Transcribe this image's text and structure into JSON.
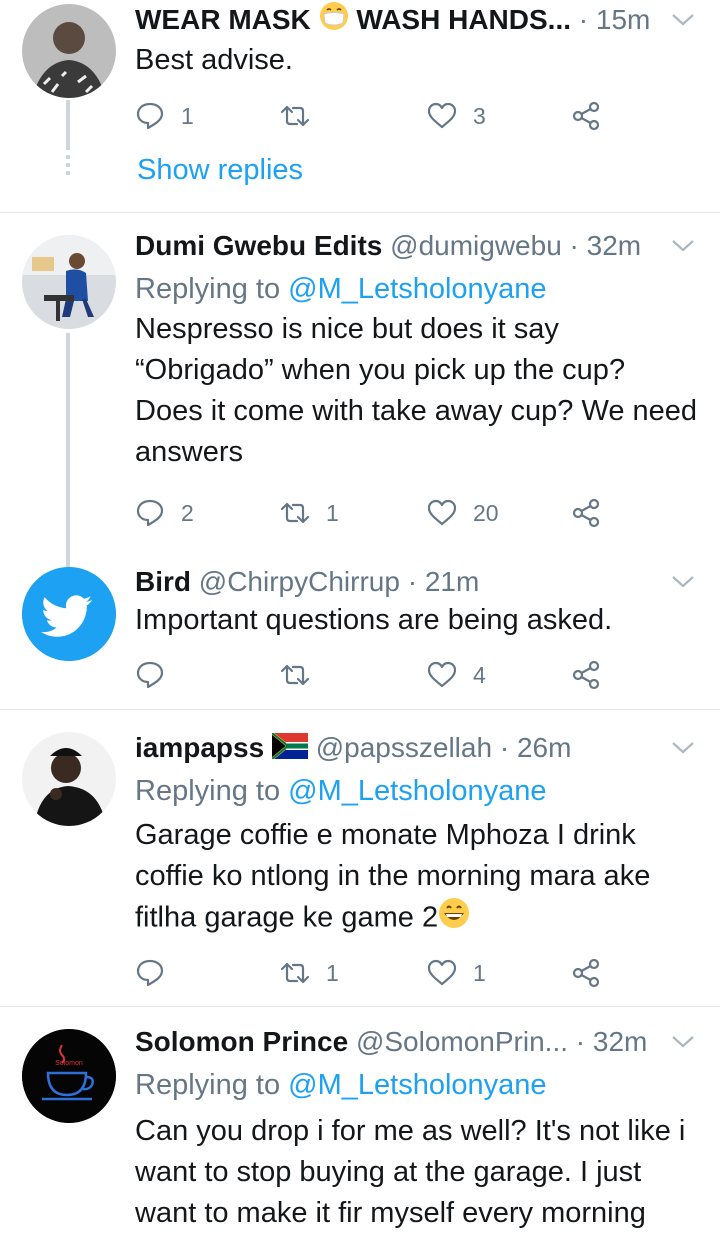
{
  "colors": {
    "accent": "#1da1f2",
    "secondary_text": "#657786",
    "divider": "#e1e8ed"
  },
  "tweets": [
    {
      "name": "WEAR MASK",
      "name_suffix": "WASH HANDS...",
      "handle": "",
      "time": "15m",
      "reply_label": "",
      "reply_to": "",
      "text": "Best advise.",
      "replies": "1",
      "retweets": "",
      "likes": "3",
      "show_replies": "Show replies"
    },
    {
      "name": "Dumi Gwebu Edits",
      "handle": "@dumigwebu",
      "time": "32m",
      "reply_label": "Replying to",
      "reply_to": "@M_Letsholonyane",
      "text": "Nespresso is nice but does it say “Obrigado” when you pick up the cup? Does it come with take away cup? We need answers",
      "replies": "2",
      "retweets": "1",
      "likes": "20"
    },
    {
      "name": "Bird",
      "handle": "@ChirpyChirrup",
      "time": "21m",
      "text": "Important questions are being asked.",
      "replies": "",
      "retweets": "",
      "likes": "4"
    },
    {
      "name": "iampapss",
      "handle": "@papsszellah",
      "time": "26m",
      "reply_label": "Replying to",
      "reply_to": "@M_Letsholonyane",
      "text": "Garage coffie e monate Mphoza I drink coffie ko ntlong in the morning mara ake fitlha garage ke game 2",
      "replies": "",
      "retweets": "1",
      "likes": "1"
    },
    {
      "name": "Solomon Prince",
      "handle": "@SolomonPrin...",
      "time": "32m",
      "reply_label": "Replying to",
      "reply_to": "@M_Letsholonyane",
      "text": "Can you drop i for me as well? It's not like i want to stop buying at the garage. I just want to make it fir myself every morning",
      "logo_text": "Solomon"
    }
  ]
}
